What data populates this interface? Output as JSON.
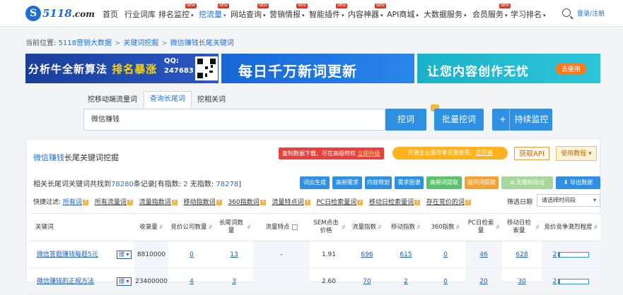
{
  "nav": {
    "logo_main": "5118",
    "logo_suffix": ".com",
    "items": [
      {
        "label": "首页",
        "caret": false,
        "new": false
      },
      {
        "label": "行业词库",
        "caret": false,
        "new": false
      },
      {
        "label": "排名监控",
        "caret": true,
        "new": true
      },
      {
        "label": "挖流量",
        "caret": true,
        "new": true
      },
      {
        "label": "网站查询",
        "caret": true,
        "new": true
      },
      {
        "label": "营销情报",
        "caret": true,
        "new": true
      },
      {
        "label": "智能插件",
        "caret": true,
        "new": true
      },
      {
        "label": "内容神器",
        "caret": true,
        "new": true
      },
      {
        "label": "API商城",
        "caret": true,
        "new": false
      },
      {
        "label": "大数据服务",
        "caret": true,
        "new": false
      },
      {
        "label": "会员服务",
        "caret": true,
        "new": true
      },
      {
        "label": "学习排名",
        "caret": true,
        "new": false
      }
    ],
    "new_badge": "NEW",
    "login": "登录/注册"
  },
  "breadcrumb": {
    "prefix": "当前位置:",
    "items": [
      "5118营销大数据",
      "关键词挖掘",
      "微信赚钱长尾关键词"
    ],
    "sep": ">"
  },
  "banners": {
    "b1_text_a": "分析牛全新算法",
    "b1_text_b": "排名暴涨",
    "b1_qq_label": "QQ:",
    "b1_qq_number": "247683",
    "b2_text": "每日千万新词更新",
    "b3_text": "让您内容创作无忧",
    "b3_button": "去使用"
  },
  "search": {
    "tabs": [
      "挖移动端流量词",
      "查询长尾词",
      "挖相关词"
    ],
    "active_tab": 1,
    "query": "微信赚钱",
    "search_button": "挖词",
    "batch_button": "批量挖词",
    "monitor_plus": "+",
    "monitor_button": "持续监控"
  },
  "panel": {
    "title_keyword": "微信赚钱",
    "title_suffix": "长尾关键词挖掘",
    "red_tag_text": "复制数据下载，尽在高级特权",
    "red_tag_link": "立即升级",
    "orange_tag_text": "开通企业版可享无限使用，",
    "orange_tag_link": "去开通",
    "api_button": "获取API",
    "help_button": "使用教程 ▾",
    "summary_a": "相关长尾词关键词共找到",
    "summary_count": "78280",
    "summary_b": "条记录[有指数:",
    "summary_with_index": "2",
    "summary_c": "无指数:",
    "summary_no_index": "78278",
    "summary_d": "]",
    "tool_buttons": [
      "词云生成",
      "高频需求",
      "内容规划",
      "需求图谱",
      "高频词提取",
      "疑问词提取",
      "⊘ 无限制导出",
      "⬇ 导出数据"
    ],
    "filters_label": "快捷过滤:",
    "filters": [
      "所有词",
      "所有流量词",
      "流量指数词",
      "移动指数词",
      "360指数词",
      "流量特点词",
      "PC日检索量词",
      "移动日检索量词",
      "存在竞价的词"
    ],
    "filter_q": "?",
    "select_label": "筛选日期",
    "select_value": "请选择时间段"
  },
  "table": {
    "headers": [
      {
        "text": "关键词",
        "sort": false
      },
      {
        "text": "收录量",
        "sort": true
      },
      {
        "text": "竞价公司数量",
        "sort": true
      },
      {
        "text": "长尾词数量",
        "sort": true
      },
      {
        "text": "流量特点",
        "sort": false
      },
      {
        "text": "SEM点击价格",
        "sort": true
      },
      {
        "text": "流量指数",
        "sort": true
      },
      {
        "text": "移动指数",
        "sort": true
      },
      {
        "text": "360指数",
        "sort": true
      },
      {
        "text": "PC日检索量",
        "sort": true
      },
      {
        "text": "移动日检索量",
        "sort": true
      },
      {
        "text": "竞价竞争激烈程度",
        "sort": true
      }
    ],
    "sort_glyph": "⇵",
    "rows": [
      {
        "keyword": "微信答题赚钱每题5元",
        "dd": "搜 ▾",
        "indexed": "8810000",
        "bid_companies": "0",
        "longtail": "13",
        "traffic_feature": "-",
        "sem_price": "1.91",
        "traffic_index": "696",
        "mobile_index": "615",
        "index_360": "0",
        "pc_daily": "46",
        "mobile_daily": "628",
        "competition": "2",
        "competition_level": 0.05
      },
      {
        "keyword": "微信赚钱的正规方法",
        "dd": "搜 ▾",
        "indexed": "23400000",
        "bid_companies": "4",
        "longtail": "3",
        "traffic_feature": "",
        "sem_price": "2.60",
        "traffic_index": "70",
        "mobile_index": "2",
        "index_360": "0",
        "pc_daily": "20",
        "mobile_daily": "30",
        "competition": "2",
        "competition_level": 0.05
      }
    ]
  }
}
